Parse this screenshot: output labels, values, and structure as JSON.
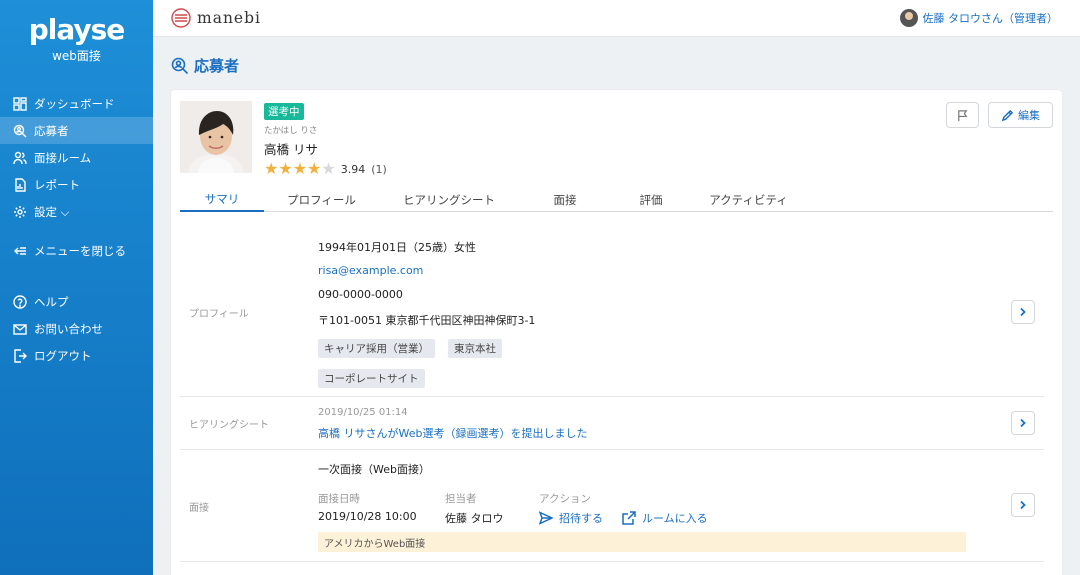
{
  "brand": {
    "logo": "playse",
    "subtitle": "web面接"
  },
  "sidebar": {
    "items": [
      {
        "label": "ダッシュボード",
        "icon": "dashboard-icon"
      },
      {
        "label": "応募者",
        "icon": "applicant-search-icon",
        "active": true
      },
      {
        "label": "面接ルーム",
        "icon": "users-icon"
      },
      {
        "label": "レポート",
        "icon": "report-icon"
      },
      {
        "label": "設定 ⌵",
        "icon": "gear-icon"
      }
    ],
    "collapse_label": "メニューを閉じる",
    "footer_items": [
      {
        "label": "ヘルプ",
        "icon": "help-icon"
      },
      {
        "label": "お問い合わせ",
        "icon": "mail-icon"
      },
      {
        "label": "ログアウト",
        "icon": "logout-icon"
      }
    ]
  },
  "header": {
    "org_name": "manebi",
    "user_label": "佐藤 タロウさん（管理者）"
  },
  "page": {
    "title": "応募者"
  },
  "candidate": {
    "status": "選考中",
    "kana": "たかはし りさ",
    "name": "高橋 リサ",
    "rating": 3.94,
    "rating_display": "3.94",
    "rating_count": "(1)",
    "stars_filled": 4,
    "stars_total": 5
  },
  "buttons": {
    "edit": "編集"
  },
  "tabs": [
    "サマリ",
    "プロフィール",
    "ヒアリングシート",
    "面接",
    "評価",
    "アクティビティ"
  ],
  "profile": {
    "section_label": "プロフィール",
    "birth_line": "1994年01月01日（25歳）女性",
    "email": "risa@example.com",
    "phone": "090-0000-0000",
    "address": "〒101-0051 東京都千代田区神田神保町3-1",
    "tags": [
      "キャリア採用（営業）",
      "東京本社",
      "コーポレートサイト"
    ]
  },
  "hearing": {
    "section_label": "ヒアリングシート",
    "timestamp": "2019/10/25 01:14",
    "message": "高橋 リサさんがWeb選考（録画選考）を提出しました"
  },
  "interview": {
    "section_label": "面接",
    "title": "一次面接（Web面接）",
    "headers": {
      "date": "面接日時",
      "owner": "担当者",
      "action": "アクション"
    },
    "date": "2019/10/28 10:00",
    "owner": "佐藤 タロウ",
    "actions": [
      "招待する",
      "ルームに入る"
    ],
    "note": "アメリカからWeb面接"
  },
  "colors": {
    "sidebar": "#1e8fd8",
    "accent": "#1a6fc2",
    "status": "#18b99a",
    "star": "#f1b23d",
    "note_bg": "#fdf1d8"
  }
}
